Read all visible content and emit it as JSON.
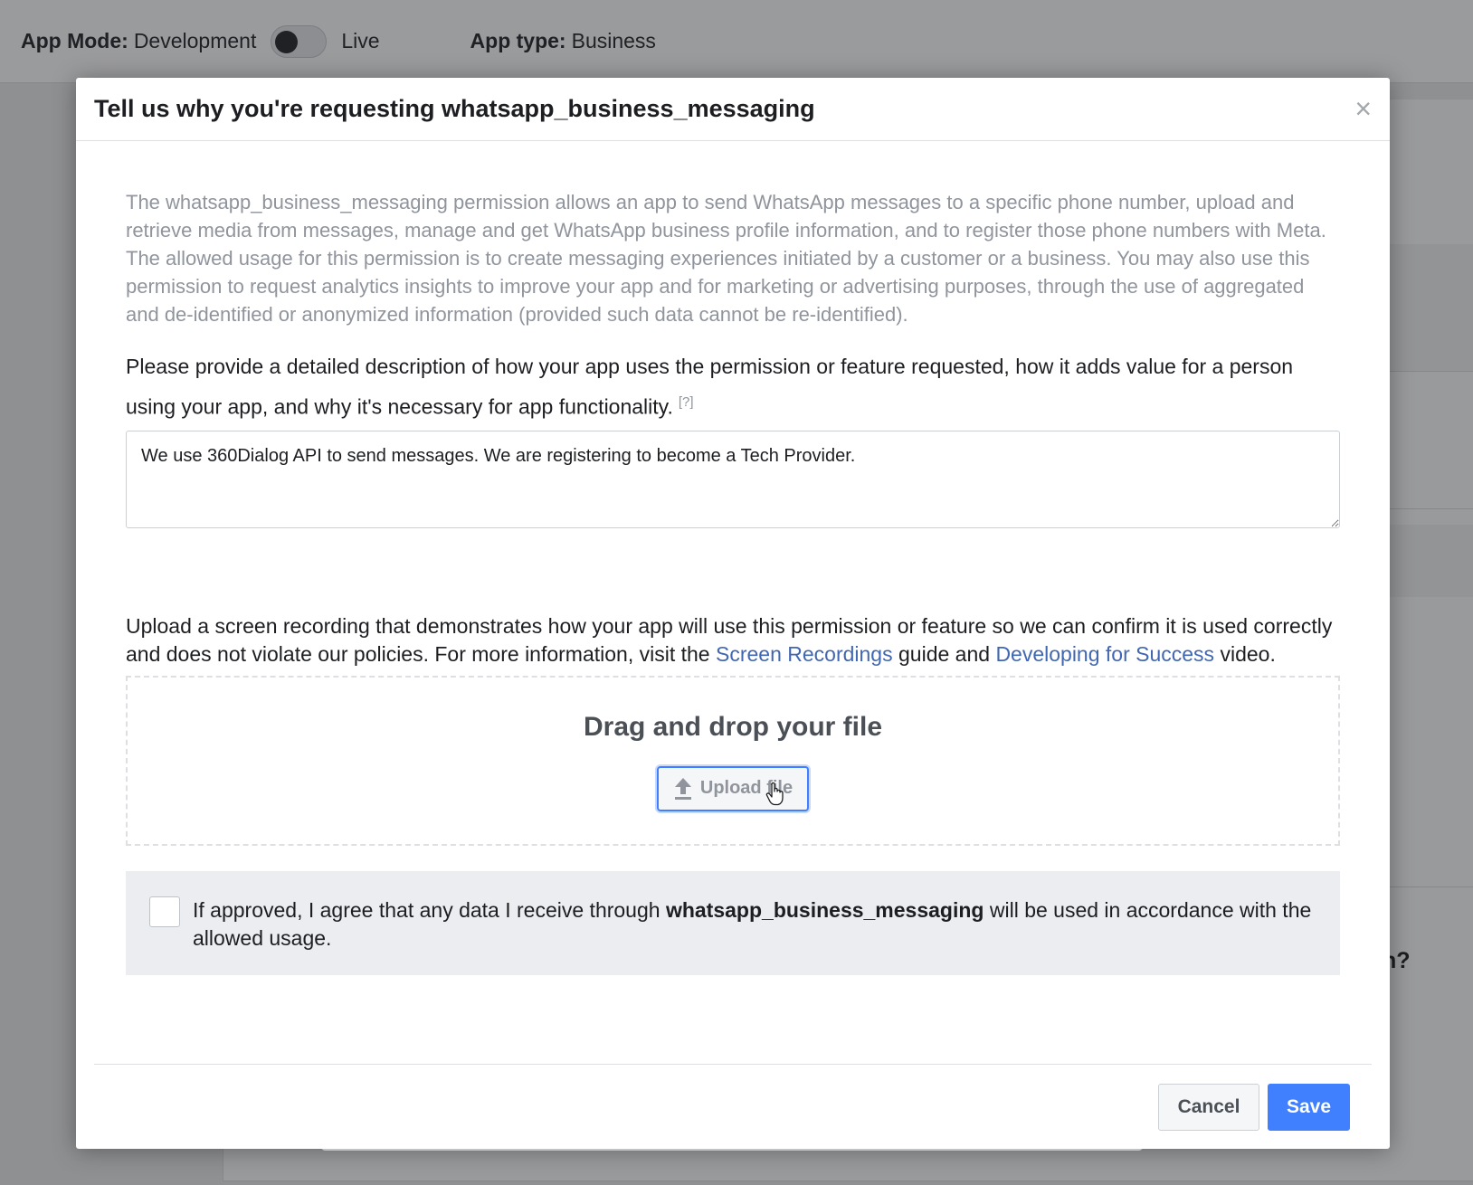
{
  "topbar": {
    "app_mode_label": "App Mode:",
    "app_mode_value": "Development",
    "toggle_on": false,
    "live_label": "Live",
    "app_type_label": "App type:",
    "app_type_value": "Business"
  },
  "background": {
    "partial_text": "n?"
  },
  "modal": {
    "title": "Tell us why you're requesting whatsapp_business_messaging",
    "close_glyph": "×",
    "permission_description": "The whatsapp_business_messaging permission allows an app to send WhatsApp messages to a specific phone number, upload and retrieve media from messages, manage and get WhatsApp business profile information, and to register those phone numbers with Meta. The allowed usage for this permission is to create messaging experiences initiated by a customer or a business. You may also use this permission to request analytics insights to improve your app and for marketing or advertising purposes, through the use of aggregated and de-identified or anonymized information (provided such data cannot be re-identified).",
    "prompt": "Please provide a detailed description of how your app uses the permission or feature requested, how it adds value for a person using your app, and why it's necessary for app functionality.",
    "help_marker": "[?]",
    "description_value": "We use 360Dialog API to send messages. We are registering to become a Tech Provider.",
    "upload_instructions": {
      "before": "Upload a screen recording that demonstrates how your app will use this permission or feature so we can confirm it is used correctly and does not violate our policies. For more information, visit the",
      "link1": "Screen Recordings",
      "middle": "guide and",
      "link2": "Developing for Success",
      "after": "video."
    },
    "dropzone": {
      "title": "Drag and drop your file",
      "button_label": "Upload file",
      "button_icon": "upload-arrow-icon"
    },
    "agreement": {
      "checked": false,
      "before": "If approved, I agree that any data I receive through",
      "permission": "whatsapp_business_messaging",
      "after": "will be used in accordance with the allowed usage."
    },
    "footer": {
      "cancel_label": "Cancel",
      "save_label": "Save"
    }
  },
  "colors": {
    "primary": "#4080ff",
    "link": "#4267b2",
    "muted_text": "#90949c",
    "overlay": "#8f9092"
  }
}
